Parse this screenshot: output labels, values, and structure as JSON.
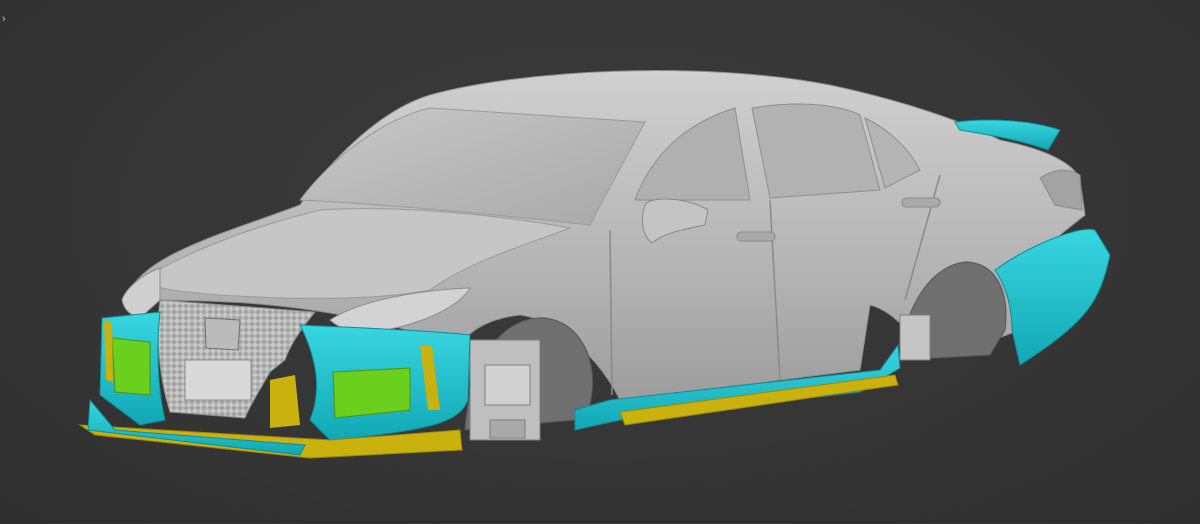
{
  "viewport": {
    "expand_glyph": "›",
    "background_color": "#363636"
  },
  "model": {
    "body_color": "#b9b9b9",
    "kit_primary_color": "#22c7d3",
    "kit_accent_color": "#c9b20e",
    "kit_insert_color": "#6bcf1e"
  }
}
